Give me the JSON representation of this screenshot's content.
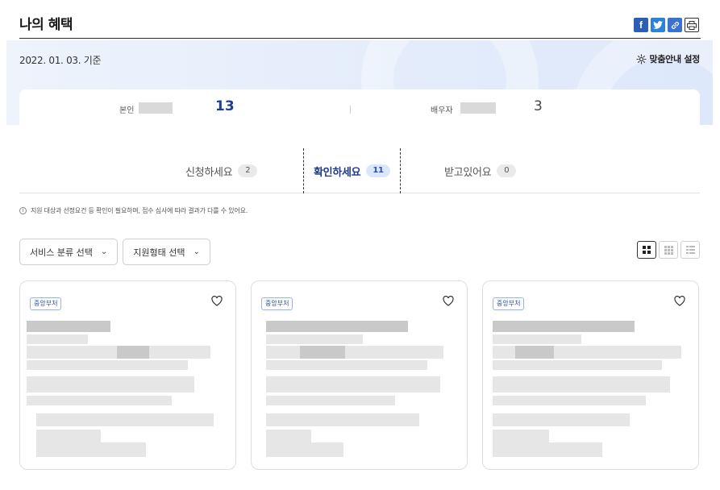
{
  "header": {
    "title": "나의 혜택",
    "share": {
      "facebook": "f",
      "twitter_icon": "twitter-icon",
      "link_icon": "link-icon",
      "print_icon": "print-icon"
    }
  },
  "banner": {
    "date": "2022. 01. 03. 기준",
    "settings_label": "맞춤안내 설정"
  },
  "counts": {
    "self_label": "본인",
    "self_count": "13",
    "spouse_label": "배우자",
    "spouse_count": "3"
  },
  "tabs": [
    {
      "label": "신청하세요",
      "count": "2"
    },
    {
      "label": "확인하세요",
      "count": "11"
    },
    {
      "label": "받고있어요",
      "count": "0"
    }
  ],
  "notice": "지원 대상과 선정요건 등 확인이 필요하며, 접수 심사에 따라 결과가 다를 수 있어요.",
  "filters": {
    "service": "서비스 분류 선택",
    "support": "지원형태 선택"
  },
  "cards": [
    {
      "tag": "중앙부처"
    },
    {
      "tag": "중앙부처"
    },
    {
      "tag": "중앙부처"
    }
  ],
  "colors": {
    "accent": "#1e3a8a",
    "banner_bg": "#e3ecfb",
    "badge_active": "#dbe6fb"
  }
}
